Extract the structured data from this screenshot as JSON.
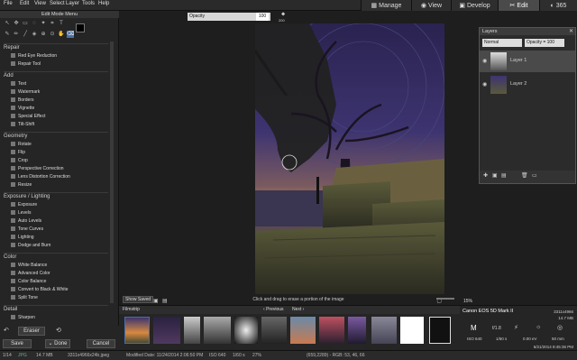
{
  "menu": [
    "File",
    "Edit",
    "View",
    "Select",
    "Layer",
    "Tools",
    "Help"
  ],
  "modes": {
    "manage": "Manage",
    "view": "View",
    "develop": "Develop",
    "edit": "Edit",
    "cloud": "365"
  },
  "left": {
    "title": "Edit Mode Menu",
    "sections": [
      {
        "title": "Repair",
        "items": [
          "Red Eye Reduction",
          "Repair Tool"
        ]
      },
      {
        "title": "Add",
        "items": [
          "Text",
          "Watermark",
          "Borders",
          "Vignette",
          "Special Effect",
          "Tilt-Shift"
        ]
      },
      {
        "title": "Geometry",
        "items": [
          "Rotate",
          "Flip",
          "Crop",
          "Perspective Correction",
          "Lens Distortion Correction",
          "Resize"
        ]
      },
      {
        "title": "Exposure / Lighting",
        "items": [
          "Exposure",
          "Levels",
          "Auto Levels",
          "Tone Curves",
          "Lighting",
          "Dodge and Burn"
        ]
      },
      {
        "title": "Color",
        "items": [
          "White Balance",
          "Advanced Color",
          "Color Balance",
          "Convert to Black & White",
          "Split Tone"
        ]
      },
      {
        "title": "Detail",
        "items": [
          "Sharpen"
        ]
      }
    ],
    "eraser": "Eraser",
    "save": "Save",
    "done": "Done",
    "cancel": "Cancel"
  },
  "toolbar": {
    "opacity_label": "Opacity",
    "opacity_value": "100",
    "size_value": "200"
  },
  "canvas": {
    "show_saved": "Show Saved",
    "message": "Click and drag to erase a portion of the image",
    "zoom": "15%"
  },
  "filmstrip": {
    "title": "Filmstrip",
    "prev": "Previous",
    "next": "Next"
  },
  "layers": {
    "title": "Layers",
    "blend": "Normal",
    "opacity": "Opacity = 100",
    "items": [
      "Layer 1",
      "Layer 2"
    ]
  },
  "info": {
    "camera": "Canon EOS 5D Mark II",
    "dims": "3311x4966",
    "size": "14.7 MB",
    "mode": "M",
    "iso": "ISO 640",
    "shutter": "1/60 s",
    "ev": "0.00 eV",
    "focal": "50 mm",
    "exposure": "f/1.8",
    "date": "6/21/2014 8:45:36 PM"
  },
  "status": {
    "index": "1/14",
    "size": "14.7 MB",
    "file": "3311x4966x24b.jpeg",
    "modified": "Modified Date: 11/24/2014 2:06:50 PM",
    "iso": "ISO 640",
    "shutter": "1/60 s",
    "zoom": "27%",
    "coords": "(659,2289) - RGB: 53, 46, 66"
  },
  "colors": {
    "accent": "#4a6fa5",
    "bg": "#1e1e1e",
    "panel": "#252525"
  }
}
